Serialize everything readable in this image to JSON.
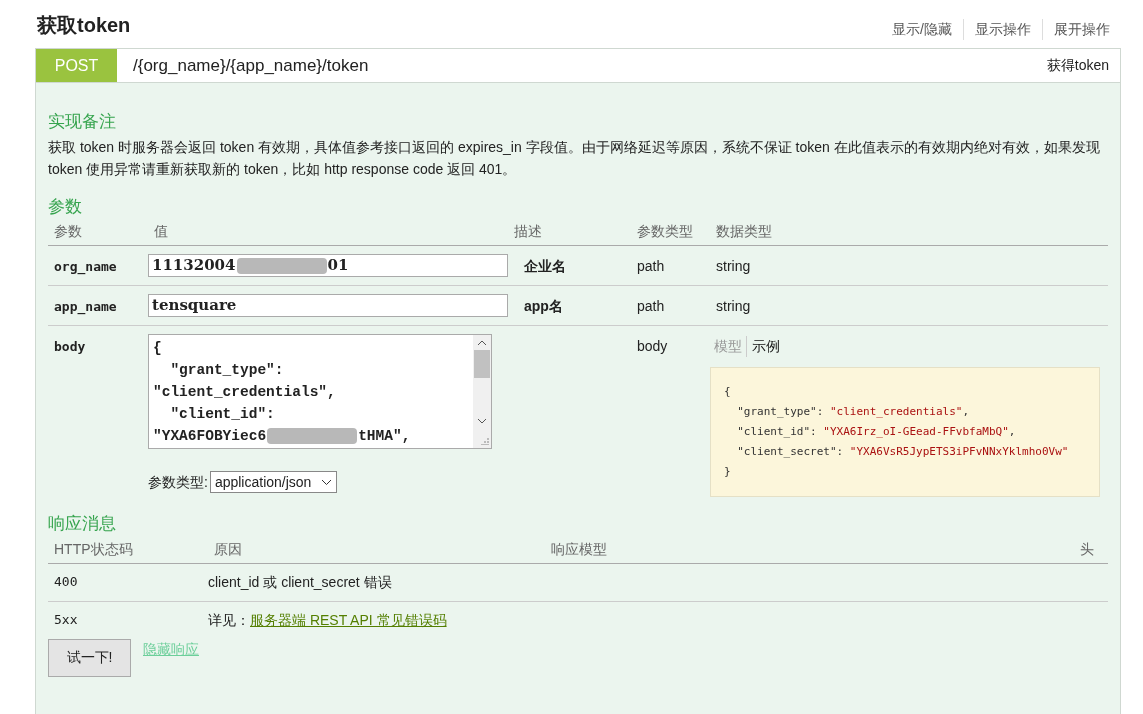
{
  "title": "获取token",
  "header_links": [
    "显示/隐藏",
    "显示操作",
    "展开操作"
  ],
  "operation": {
    "method": "POST",
    "path": "/{org_name}/{app_name}/token",
    "summary": "获得token"
  },
  "notes": {
    "heading": "实现备注",
    "text": "获取 token 时服务器会返回 token 有效期，具体值参考接口返回的 expires_in 字段值。由于网络延迟等原因，系统不保证 token 在此值表示的有效期内绝对有效，如果发现 token 使用异常请重新获取新的 token，比如 http response code 返回 401。"
  },
  "parameters": {
    "heading": "参数",
    "columns": [
      "参数",
      "值",
      "描述",
      "参数类型",
      "数据类型"
    ],
    "rows": [
      {
        "kind": "input",
        "name": "org_name",
        "value": [
          {
            "kind": "text",
            "text": "11132004"
          },
          {
            "kind": "redacted"
          },
          {
            "kind": "text",
            "text": "01"
          }
        ],
        "description": "企业名",
        "param_type": "path",
        "data_type": "string"
      },
      {
        "kind": "input",
        "name": "app_name",
        "value": [
          {
            "kind": "text",
            "text": "tensquare"
          }
        ],
        "description": "app名",
        "param_type": "path",
        "data_type": "string"
      },
      {
        "kind": "body",
        "name": "body",
        "lines": [
          [
            {
              "kind": "text",
              "text": "{"
            }
          ],
          [
            {
              "kind": "text",
              "text": "  \"grant_type\":"
            }
          ],
          [
            {
              "kind": "text",
              "text": "\"client_credentials\","
            }
          ],
          [
            {
              "kind": "text",
              "text": "  \"client_id\":"
            }
          ],
          [
            {
              "kind": "text",
              "text": "\"YXA6FOBYiec6"
            },
            {
              "kind": "redacted"
            },
            {
              "kind": "text",
              "text": "tHMA\","
            }
          ]
        ],
        "content_type_label": "参数类型:",
        "content_type": "application/json",
        "param_type": "body",
        "model_tabs": [
          {
            "label": "模型",
            "selected": false
          },
          {
            "label": "示例",
            "selected": true
          }
        ],
        "example": [
          [
            {
              "kind": "plain",
              "text": "{"
            }
          ],
          [
            {
              "kind": "plain",
              "text": "  \"grant_type\": "
            },
            {
              "kind": "string",
              "text": "\"client_credentials\""
            },
            {
              "kind": "plain",
              "text": ","
            }
          ],
          [
            {
              "kind": "plain",
              "text": "  \"client_id\": "
            },
            {
              "kind": "string",
              "text": "\"YXA6Irz_oI-GEead-FFvbfaMbQ\""
            },
            {
              "kind": "plain",
              "text": ","
            }
          ],
          [
            {
              "kind": "plain",
              "text": "  \"client_secret\": "
            },
            {
              "kind": "string",
              "text": "\"YXA6VsR5JypETS3iPFvNNxYklmho0Vw\""
            }
          ],
          [
            {
              "kind": "plain",
              "text": "}"
            }
          ]
        ]
      }
    ]
  },
  "responses": {
    "heading": "响应消息",
    "columns": [
      "HTTP状态码",
      "原因",
      "响应模型",
      "头"
    ],
    "rows": [
      {
        "code": "400",
        "reason": "client_id 或 client_secret 错误"
      },
      {
        "code": "5xx",
        "reason": "详见：",
        "link": "服务器端 REST API 常见错误码"
      }
    ]
  },
  "try_button": "试一下!",
  "hide_link": "隐藏响应"
}
